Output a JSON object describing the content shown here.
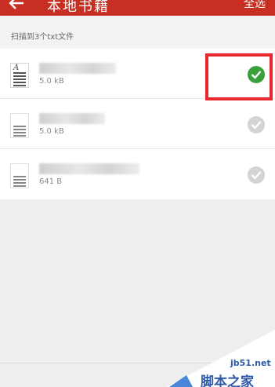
{
  "header": {
    "title": "本地书籍",
    "select_all": "全选"
  },
  "summary": "扫描到3个txt文件",
  "files": [
    {
      "size": "5.0 kB",
      "selected": true
    },
    {
      "size": "5.0 kB",
      "selected": false
    },
    {
      "size": "641 B",
      "selected": false
    }
  ],
  "watermark": {
    "domain": "jb51.net",
    "name": "脚本之家"
  },
  "colors": {
    "header": "#c62f22",
    "check_on": "#3aa13a",
    "check_off": "#d4d4d4",
    "highlight": "#e8282e"
  }
}
